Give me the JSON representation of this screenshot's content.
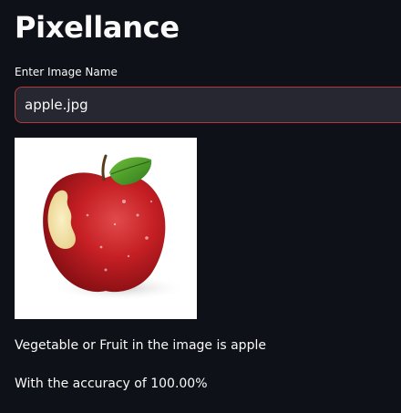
{
  "app": {
    "title": "Pixellance"
  },
  "input": {
    "label": "Enter Image Name",
    "value": "apple.jpg",
    "border_color": "#b33a3a"
  },
  "image": {
    "subject": "apple-photo",
    "alt": "apple.jpg"
  },
  "results": {
    "prediction_line": "Vegetable or Fruit in the image is apple",
    "accuracy_line": "With the accuracy of 100.00%"
  },
  "colors": {
    "background": "#0e1117",
    "text": "#fafafa",
    "input_background": "#262730"
  }
}
